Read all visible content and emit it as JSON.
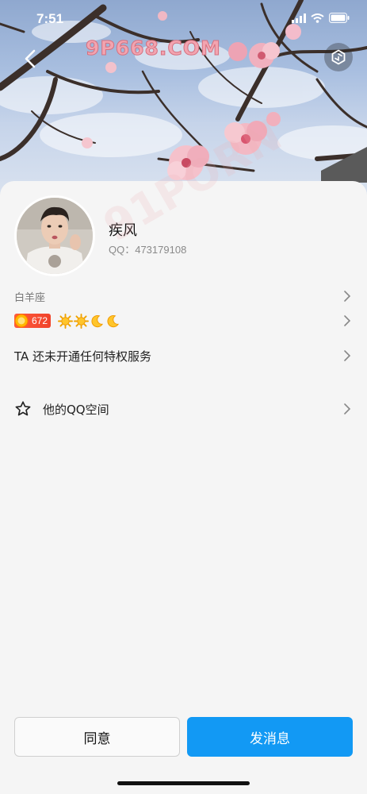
{
  "status_bar": {
    "time": "7:51"
  },
  "watermark": {
    "text": "9P668.COM",
    "diag_text": "91PORN"
  },
  "profile": {
    "nickname": "疾风",
    "qq_label": "QQ：473179108",
    "constellation": "白羊座",
    "level": "672",
    "level_icons": [
      "sun-icon",
      "sun-icon",
      "moon-icon",
      "moon-icon"
    ]
  },
  "rows": {
    "privilege": "TA 还未开通任何特权服务",
    "qzone": "他的QQ空间"
  },
  "buttons": {
    "agree": "同意",
    "message": "发消息"
  },
  "colors": {
    "primary": "#1299f4",
    "level_badge": "#f0432a",
    "background": "#f5f5f5"
  }
}
